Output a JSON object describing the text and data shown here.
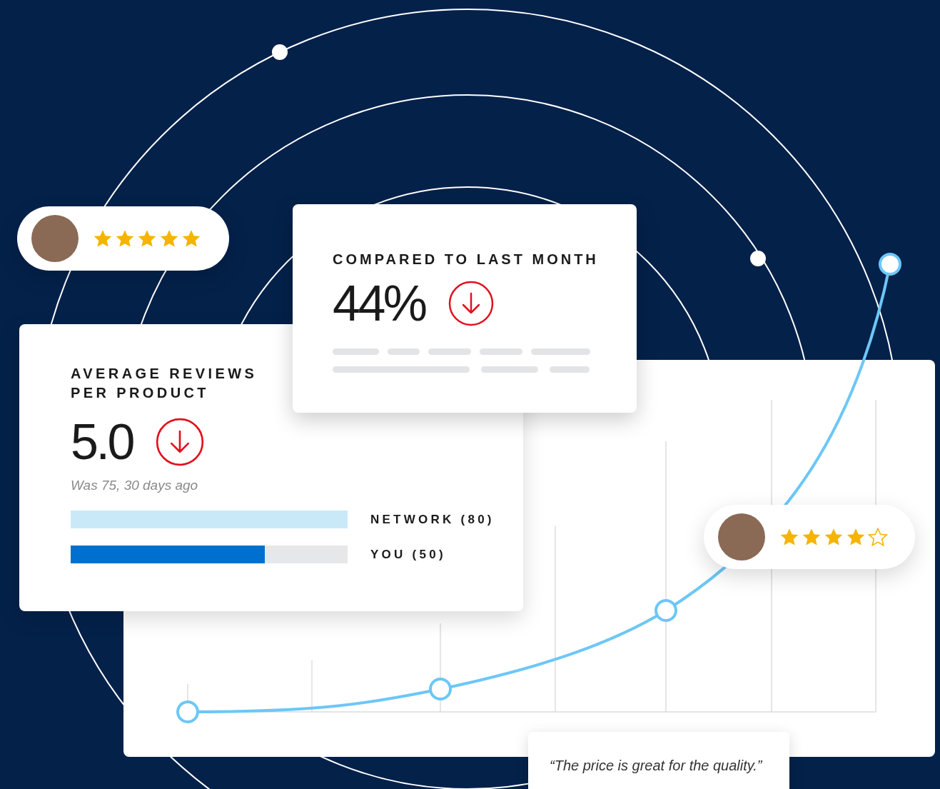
{
  "review_bubbles": [
    {
      "stars": 5
    },
    {
      "stars": 4
    }
  ],
  "comparison_card": {
    "title": "COMPARED TO LAST MONTH",
    "value": "44%"
  },
  "average_card": {
    "title_lines": [
      "AVERAGE REVIEWS",
      "PER PRODUCT"
    ],
    "value": "5.0",
    "note": "Was 75, 30 days ago",
    "bars": [
      {
        "label": "NETWORK (80)",
        "level": 1.0,
        "kind": "light"
      },
      {
        "label": "YOU (50)",
        "level": 0.7,
        "kind": "dark"
      }
    ]
  },
  "quote": "“The price is great for the quality.”"
}
